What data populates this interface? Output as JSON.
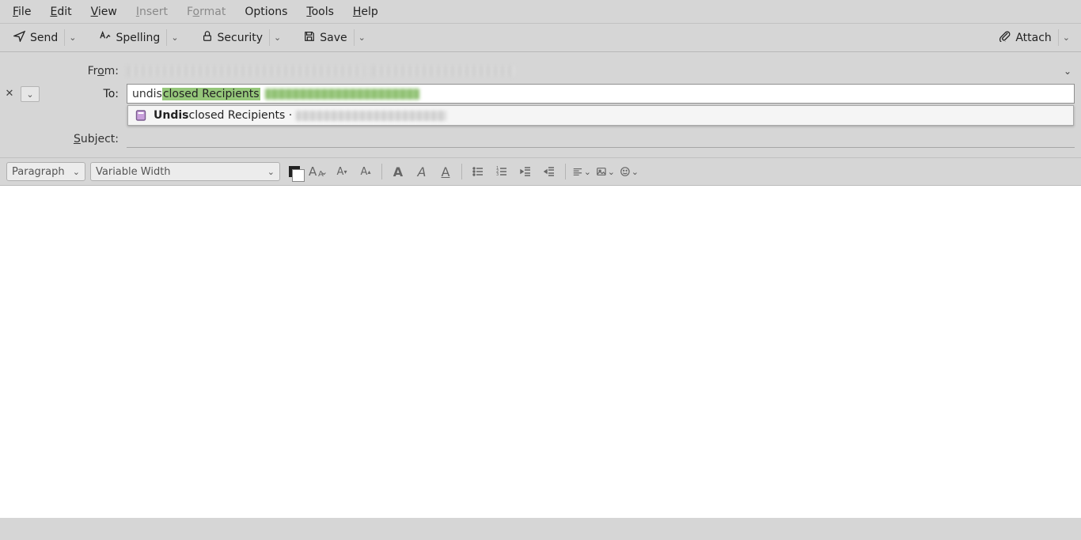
{
  "menu": {
    "file": "File",
    "edit": "Edit",
    "view": "View",
    "insert": "Insert",
    "format": "Format",
    "options": "Options",
    "tools": "Tools",
    "help": "Help"
  },
  "toolbar": {
    "send": "Send",
    "spelling": "Spelling",
    "security": "Security",
    "save": "Save",
    "attach": "Attach"
  },
  "headers": {
    "from_label": "From:",
    "to_label": "To:",
    "subject_label": "Subject:"
  },
  "to_field": {
    "typed": "undis",
    "selected_completion": "closed Recipients"
  },
  "autocomplete": {
    "match_bold": "Undis",
    "match_rest": "closed Recipients",
    "separator": " · "
  },
  "format_bar": {
    "paragraph": "Paragraph",
    "font": "Variable Width"
  }
}
